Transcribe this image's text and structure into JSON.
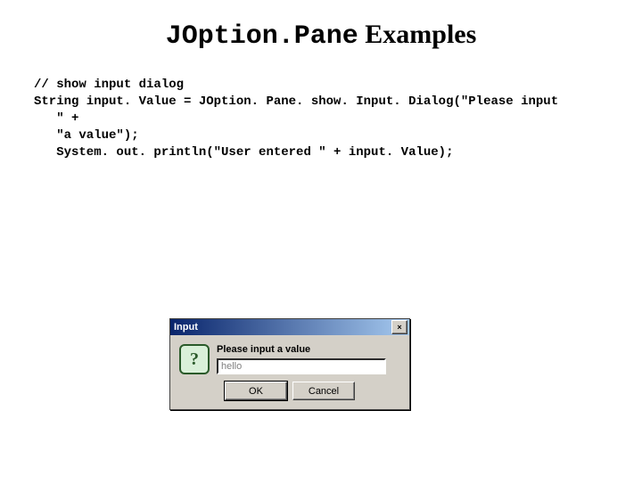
{
  "title": {
    "code": "JOption.Pane",
    "word": " Examples"
  },
  "code": {
    "l1": "// show input dialog",
    "l2": "String input. Value = JOption. Pane. show. Input. Dialog(\"Please input",
    "l3": "   \" +",
    "l4": "   \"a value\");",
    "l5": "   System. out. println(\"User entered \" + input. Value);"
  },
  "dialog": {
    "title": "Input",
    "close": "×",
    "icon_glyph": "?",
    "message": "Please input a value",
    "input_value": "hello",
    "ok": "OK",
    "cancel": "Cancel"
  }
}
